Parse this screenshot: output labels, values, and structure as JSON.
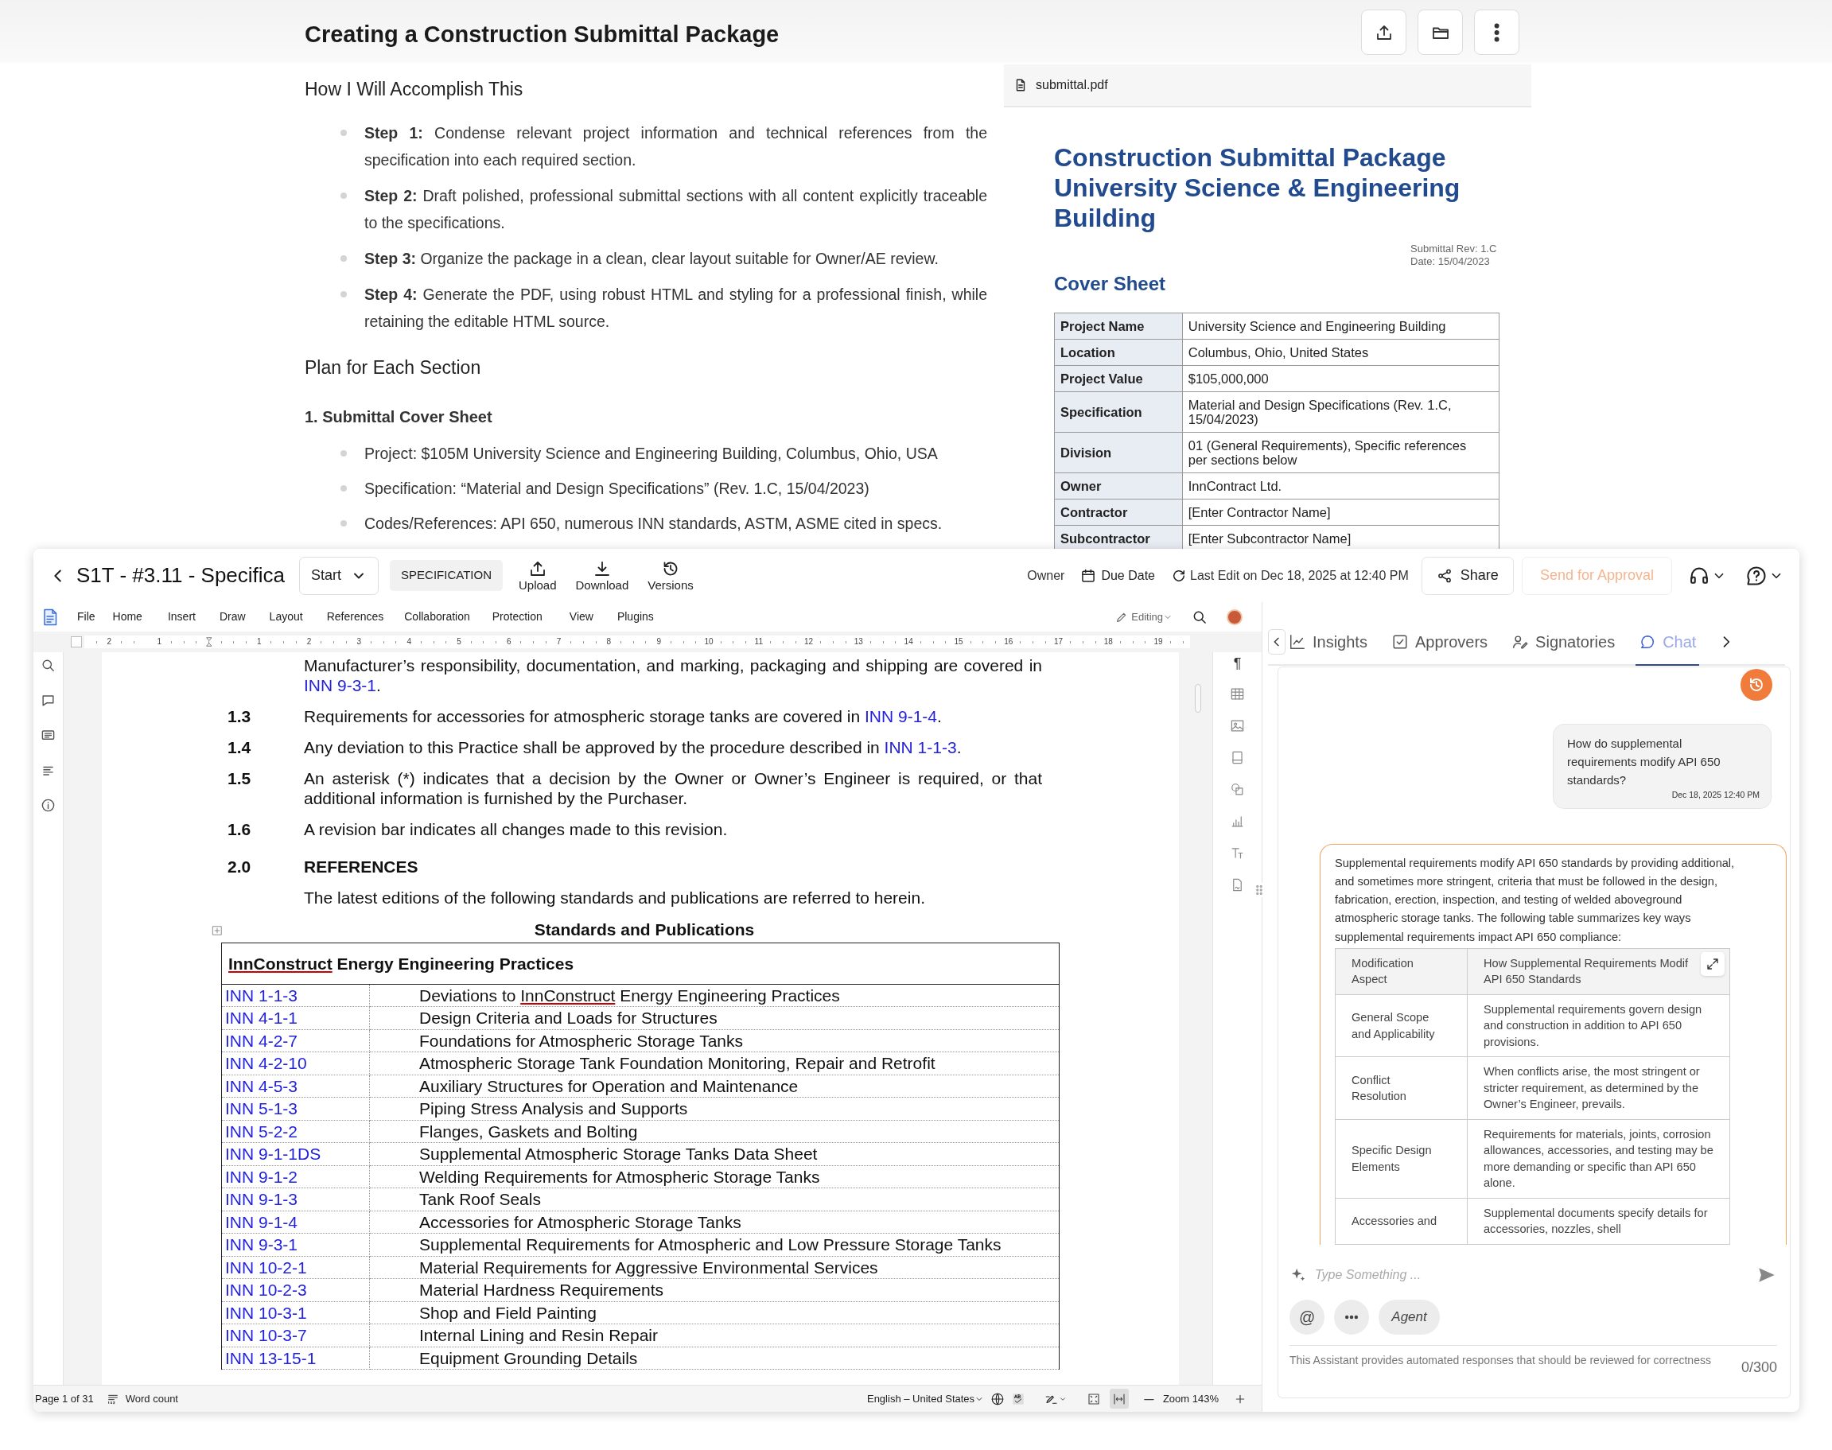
{
  "plan": {
    "title": "Creating a Construction Submittal Package",
    "heading": "How I Will Accomplish This",
    "steps": [
      "**Step 1:** Condense relevant project information and technical references from the specification into each required section.",
      "**Step 2:** Draft polished, professional submittal sections with all content explicitly traceable to the specifications.",
      "**Step 3:** Organize the package in a clean, clear layout suitable for Owner/AE review.",
      "**Step 4:** Generate the PDF, using robust HTML and styling for a professional finish, while retaining the editable HTML source."
    ],
    "section_heading": "Plan for Each Section",
    "subheading": "1. Submittal Cover Sheet",
    "bullets": [
      "Project: $105M University Science and Engineering Building, Columbus, Ohio, USA",
      "Specification: “Material and Design Specifications” (Rev. 1.C, 15/04/2023)",
      "Codes/References: API 650, numerous INN standards, ASTM, ASME cited in specs."
    ]
  },
  "pdf": {
    "filename": "submittal.pdf",
    "title_lines": [
      "Construction Submittal Package",
      "University Science & Engineering Building"
    ],
    "revision_lines": [
      "Submittal Rev: 1.C",
      "Date: 15/04/2023"
    ],
    "section": "Cover Sheet",
    "rows": [
      {
        "label": "Project Name",
        "value": "University Science and Engineering Building"
      },
      {
        "label": "Location",
        "value": "Columbus, Ohio, United States"
      },
      {
        "label": "Project Value",
        "value": "$105,000,000"
      },
      {
        "label": "Specification",
        "value": "Material and Design Specifications (Rev. 1.C, 15/04/2023)"
      },
      {
        "label": "Division",
        "value": "01 (General Requirements), Specific references per sections below"
      },
      {
        "label": "Owner",
        "value": "InnContract Ltd."
      },
      {
        "label": "Contractor",
        "value": "[Enter Contractor Name]"
      },
      {
        "label": "Subcontractor",
        "value": "[Enter Subcontractor Name]"
      }
    ]
  },
  "app": {
    "title": "S1T - #3.11 - Specifica",
    "start": "Start",
    "doc_type": "SPECIFICATION",
    "actions": [
      {
        "kind": "upload",
        "label": "Upload"
      },
      {
        "kind": "download",
        "label": "Download"
      },
      {
        "kind": "versions",
        "label": "Versions"
      }
    ],
    "owner": "Owner",
    "due_date": "Due Date",
    "last_edit": "Last Edit on Dec 18, 2025 at 12:40 PM",
    "share": "Share",
    "send": {
      "label": "Send for Approval",
      "disabled": true
    }
  },
  "editor": {
    "menu": [
      "File",
      "Home",
      "Insert",
      "Draw",
      "Layout",
      "References",
      "Collaboration",
      "Protection",
      "View",
      "Plugins"
    ],
    "mode": "Editing",
    "ruler": [
      {
        "text": "2"
      },
      {
        "text": "1"
      },
      {
        "kind": "indent-marker"
      },
      {
        "text": "1"
      },
      {
        "text": "2"
      },
      {
        "text": "3"
      },
      {
        "text": "4"
      },
      {
        "text": "5"
      },
      {
        "text": "6"
      },
      {
        "text": "7"
      },
      {
        "text": "8"
      },
      {
        "text": "9"
      },
      {
        "text": "10"
      },
      {
        "text": "11"
      },
      {
        "text": "12"
      },
      {
        "text": "13"
      },
      {
        "text": "14"
      },
      {
        "text": "15"
      },
      {
        "text": "16"
      },
      {
        "text": "17"
      },
      {
        "text": "18"
      },
      {
        "text": "19"
      }
    ],
    "paragraph_mark": "¶",
    "paragraphs": [
      {
        "kind": "para",
        "parts": [
          {
            "text": "Manufacturer’s responsibility, documentation, and marking, packaging and shipping are covered in "
          },
          {
            "kind": "link",
            "text": "INN 9-3-1"
          },
          {
            "text": "."
          }
        ]
      },
      {
        "kind": "para",
        "number": "1.3",
        "parts": [
          {
            "text": "Requirements for accessories for atmospheric storage tanks are covered in "
          },
          {
            "kind": "link",
            "text": "INN 9-1-4"
          },
          {
            "text": "."
          }
        ]
      },
      {
        "kind": "para",
        "number": "1.4",
        "parts": [
          {
            "text": "Any deviation to this Practice shall be approved by the procedure described in "
          },
          {
            "kind": "link",
            "text": "INN 1-1-3"
          },
          {
            "text": "."
          }
        ]
      },
      {
        "kind": "para",
        "number": "1.5",
        "parts": [
          {
            "text": "An asterisk (*) indicates that a decision by the Owner or Owner’s Engineer is required, or that additional information is furnished by the Purchaser."
          }
        ]
      },
      {
        "kind": "para",
        "number": "1.6",
        "parts": [
          {
            "text": "A revision bar indicates all changes made to this revision."
          }
        ]
      },
      {
        "kind": "heading",
        "number": "2.0",
        "parts": [
          {
            "text": "REFERENCES"
          }
        ]
      },
      {
        "kind": "para",
        "parts": [
          {
            "text": "The latest editions of the following standards and publications are referred to herein."
          }
        ]
      }
    ],
    "table": {
      "caption": "Standards and Publications",
      "header": [
        {
          "kind": "misspelled",
          "text": "InnConstruct"
        },
        {
          "text": " Energy Engineering Practices"
        }
      ],
      "rows": [
        {
          "code": "INN 1-1-3",
          "title": [
            {
              "text": "Deviations to "
            },
            {
              "kind": "misspelled",
              "text": "InnConstruct"
            },
            {
              "text": " Energy Engineering Practices"
            }
          ]
        },
        {
          "code": "INN 4-1-1",
          "title": [
            {
              "text": "Design Criteria and Loads for Structures"
            }
          ]
        },
        {
          "code": "INN 4-2-7",
          "title": [
            {
              "text": "Foundations for Atmospheric Storage Tanks"
            }
          ]
        },
        {
          "code": "INN 4-2-10",
          "title": [
            {
              "text": "Atmospheric Storage Tank Foundation Monitoring, Repair and Retrofit"
            }
          ]
        },
        {
          "code": "INN 4-5-3",
          "title": [
            {
              "text": "Auxiliary Structures for Operation and Maintenance"
            }
          ]
        },
        {
          "code": "INN 5-1-3",
          "title": [
            {
              "text": "Piping Stress Analysis and Supports"
            }
          ]
        },
        {
          "code": "INN 5-2-2",
          "title": [
            {
              "text": "Flanges, Gaskets and Bolting"
            }
          ]
        },
        {
          "code": "INN 9-1-1DS",
          "title": [
            {
              "text": "Supplemental Atmospheric Storage Tanks Data Sheet"
            }
          ]
        },
        {
          "code": "INN 9-1-2",
          "title": [
            {
              "text": "Welding Requirements for Atmospheric Storage Tanks"
            }
          ]
        },
        {
          "code": "INN 9-1-3",
          "title": [
            {
              "text": "Tank Roof Seals"
            }
          ]
        },
        {
          "code": "INN 9-1-4",
          "title": [
            {
              "text": "Accessories for Atmospheric Storage Tanks"
            }
          ]
        },
        {
          "code": "INN 9-3-1",
          "title": [
            {
              "text": "Supplemental Requirements for Atmospheric and Low Pressure Storage Tanks"
            }
          ]
        },
        {
          "code": "INN 10-2-1",
          "title": [
            {
              "text": "Material Requirements for Aggressive Environmental Services"
            }
          ]
        },
        {
          "code": "INN 10-2-3",
          "title": [
            {
              "text": "Material Hardness Requirements"
            }
          ]
        },
        {
          "code": "INN 10-3-1",
          "title": [
            {
              "text": "Shop and Field Painting"
            }
          ]
        },
        {
          "code": "INN 10-3-7",
          "title": [
            {
              "text": "Internal Lining and Resin Repair"
            }
          ]
        },
        {
          "code": "INN 13-15-1",
          "title": [
            {
              "text": "Equipment Grounding Details"
            }
          ]
        }
      ]
    },
    "status": {
      "page": "Page 1 of 31",
      "word_count": "Word count",
      "language": "English – United States",
      "zoom": "Zoom 143%",
      "view_modes": [
        {
          "kind": "fit-page",
          "selected": false
        },
        {
          "kind": "fit-width",
          "selected": true
        }
      ]
    }
  },
  "chat": {
    "tabs": [
      {
        "kind": "insights",
        "label": "Insights",
        "selected": false
      },
      {
        "kind": "approvers",
        "label": "Approvers",
        "selected": false
      },
      {
        "kind": "signatories",
        "label": "Signatories",
        "selected": false
      },
      {
        "kind": "chat",
        "label": "Chat",
        "selected": true
      }
    ],
    "user_message": {
      "text": "How do supplemental requirements modify API 650 standards?",
      "time": "Dec 18, 2025 12:40 PM"
    },
    "reply": {
      "text": "Supplemental requirements modify API 650 standards by providing additional, and sometimes more stringent, criteria that must be followed in the design, fabrication, erection, inspection, and testing of welded aboveground atmospheric storage tanks. The following table summarizes key ways supplemental requirements impact API 650 compliance:",
      "columns": [
        "Modification Aspect",
        "How Supplemental Requirements Modif\nAPI 650 Standards"
      ],
      "rows": [
        [
          "General Scope and Applicability",
          "Supplemental requirements govern design and construction in addition to API 650 provisions."
        ],
        [
          "Conflict Resolution",
          "When conflicts arise, the most stringent or stricter requirement, as determined by the Owner’s Engineer, prevails."
        ],
        [
          "Specific Design Elements",
          "Requirements for materials, joints, corrosion allowances, accessories, and testing may be more demanding or specific than API 650 alone."
        ],
        [
          "Accessories and",
          "Supplemental documents specify details for accessories, nozzles, shell"
        ]
      ]
    },
    "input": {
      "placeholder": "Type Something ...",
      "chips": [
        {
          "kind": "mention",
          "label": "@"
        },
        {
          "kind": "more"
        },
        {
          "kind": "agent",
          "label": "Agent"
        }
      ]
    },
    "disclaimer": "This Assistant provides automated responses that should be reviewed for correctness",
    "counter": "0/300"
  }
}
